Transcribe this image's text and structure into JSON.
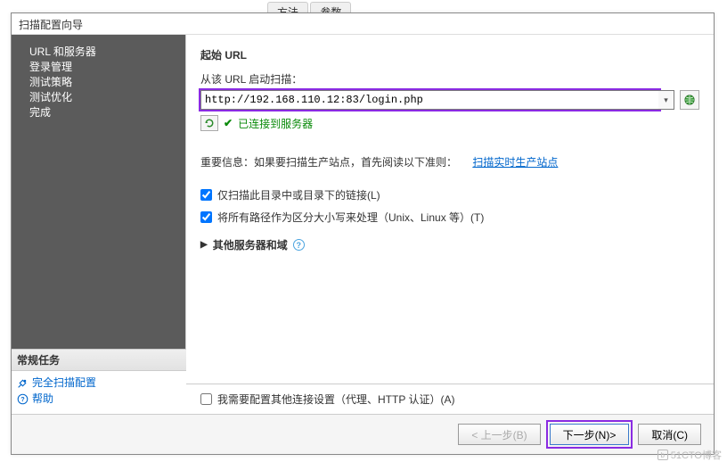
{
  "background": {
    "tab1": "方法",
    "tab2": "参数"
  },
  "dialog": {
    "title": "扫描配置向导"
  },
  "sidebar": {
    "steps": [
      {
        "label": "URL 和服务器",
        "active": true
      },
      {
        "label": "登录管理",
        "active": false
      },
      {
        "label": "测试策略",
        "active": false
      },
      {
        "label": "测试优化",
        "active": false
      },
      {
        "label": "完成",
        "active": false
      }
    ]
  },
  "commonTasks": {
    "header": "常规任务",
    "fullScanConfig": "完全扫描配置",
    "help": "帮助"
  },
  "main": {
    "sectionTitle": "起始 URL",
    "instruction": "从该 URL 启动扫描：",
    "urlValue": "http://192.168.110.12:83/login.php",
    "connectedStatus": "已连接到服务器",
    "importantLabel": "重要信息：如果要扫描生产站点，首先阅读以下准则：",
    "importantLink": "扫描实时生产站点",
    "check1": "仅扫描此目录中或目录下的链接(L)",
    "check2": "将所有路径作为区分大小写来处理（Unix、Linux 等）(T)",
    "expanderLabel": "其他服务器和域"
  },
  "bottom": {
    "extraOption": "我需要配置其他连接设置（代理、HTTP 认证）(A)"
  },
  "buttons": {
    "back": "< 上一步(B)",
    "next": "下一步(N)>",
    "cancel": "取消(C)"
  },
  "watermark": "51CTO博客"
}
